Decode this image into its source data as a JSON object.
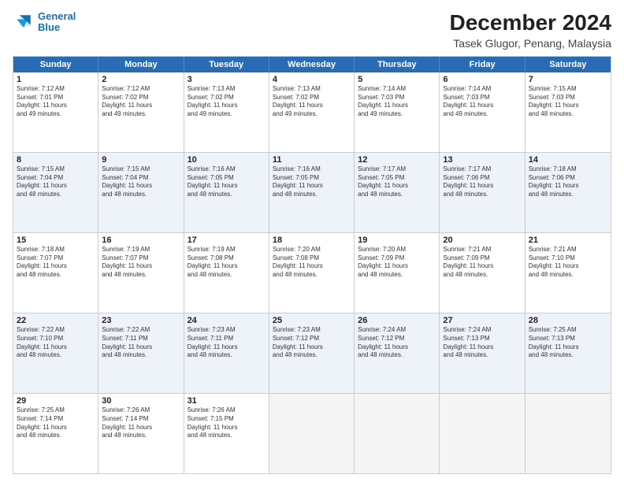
{
  "logo": {
    "line1": "General",
    "line2": "Blue"
  },
  "title": "December 2024",
  "subtitle": "Tasek Glugor, Penang, Malaysia",
  "days_of_week": [
    "Sunday",
    "Monday",
    "Tuesday",
    "Wednesday",
    "Thursday",
    "Friday",
    "Saturday"
  ],
  "weeks": [
    [
      {
        "day": "1",
        "sunrise": "7:12 AM",
        "sunset": "7:01 PM",
        "daylight": "11 hours and 49 minutes."
      },
      {
        "day": "2",
        "sunrise": "7:12 AM",
        "sunset": "7:02 PM",
        "daylight": "11 hours and 49 minutes."
      },
      {
        "day": "3",
        "sunrise": "7:13 AM",
        "sunset": "7:02 PM",
        "daylight": "11 hours and 49 minutes."
      },
      {
        "day": "4",
        "sunrise": "7:13 AM",
        "sunset": "7:02 PM",
        "daylight": "11 hours and 49 minutes."
      },
      {
        "day": "5",
        "sunrise": "7:14 AM",
        "sunset": "7:03 PM",
        "daylight": "11 hours and 49 minutes."
      },
      {
        "day": "6",
        "sunrise": "7:14 AM",
        "sunset": "7:03 PM",
        "daylight": "11 hours and 49 minutes."
      },
      {
        "day": "7",
        "sunrise": "7:15 AM",
        "sunset": "7:03 PM",
        "daylight": "11 hours and 48 minutes."
      }
    ],
    [
      {
        "day": "8",
        "sunrise": "7:15 AM",
        "sunset": "7:04 PM",
        "daylight": "11 hours and 48 minutes."
      },
      {
        "day": "9",
        "sunrise": "7:15 AM",
        "sunset": "7:04 PM",
        "daylight": "11 hours and 48 minutes."
      },
      {
        "day": "10",
        "sunrise": "7:16 AM",
        "sunset": "7:05 PM",
        "daylight": "11 hours and 48 minutes."
      },
      {
        "day": "11",
        "sunrise": "7:16 AM",
        "sunset": "7:05 PM",
        "daylight": "11 hours and 48 minutes."
      },
      {
        "day": "12",
        "sunrise": "7:17 AM",
        "sunset": "7:05 PM",
        "daylight": "11 hours and 48 minutes."
      },
      {
        "day": "13",
        "sunrise": "7:17 AM",
        "sunset": "7:06 PM",
        "daylight": "11 hours and 48 minutes."
      },
      {
        "day": "14",
        "sunrise": "7:18 AM",
        "sunset": "7:06 PM",
        "daylight": "11 hours and 48 minutes."
      }
    ],
    [
      {
        "day": "15",
        "sunrise": "7:18 AM",
        "sunset": "7:07 PM",
        "daylight": "11 hours and 48 minutes."
      },
      {
        "day": "16",
        "sunrise": "7:19 AM",
        "sunset": "7:07 PM",
        "daylight": "11 hours and 48 minutes."
      },
      {
        "day": "17",
        "sunrise": "7:19 AM",
        "sunset": "7:08 PM",
        "daylight": "11 hours and 48 minutes."
      },
      {
        "day": "18",
        "sunrise": "7:20 AM",
        "sunset": "7:08 PM",
        "daylight": "11 hours and 48 minutes."
      },
      {
        "day": "19",
        "sunrise": "7:20 AM",
        "sunset": "7:09 PM",
        "daylight": "11 hours and 48 minutes."
      },
      {
        "day": "20",
        "sunrise": "7:21 AM",
        "sunset": "7:09 PM",
        "daylight": "11 hours and 48 minutes."
      },
      {
        "day": "21",
        "sunrise": "7:21 AM",
        "sunset": "7:10 PM",
        "daylight": "11 hours and 48 minutes."
      }
    ],
    [
      {
        "day": "22",
        "sunrise": "7:22 AM",
        "sunset": "7:10 PM",
        "daylight": "11 hours and 48 minutes."
      },
      {
        "day": "23",
        "sunrise": "7:22 AM",
        "sunset": "7:11 PM",
        "daylight": "11 hours and 48 minutes."
      },
      {
        "day": "24",
        "sunrise": "7:23 AM",
        "sunset": "7:11 PM",
        "daylight": "11 hours and 48 minutes."
      },
      {
        "day": "25",
        "sunrise": "7:23 AM",
        "sunset": "7:12 PM",
        "daylight": "11 hours and 48 minutes."
      },
      {
        "day": "26",
        "sunrise": "7:24 AM",
        "sunset": "7:12 PM",
        "daylight": "11 hours and 48 minutes."
      },
      {
        "day": "27",
        "sunrise": "7:24 AM",
        "sunset": "7:13 PM",
        "daylight": "11 hours and 48 minutes."
      },
      {
        "day": "28",
        "sunrise": "7:25 AM",
        "sunset": "7:13 PM",
        "daylight": "11 hours and 48 minutes."
      }
    ],
    [
      {
        "day": "29",
        "sunrise": "7:25 AM",
        "sunset": "7:14 PM",
        "daylight": "11 hours and 48 minutes."
      },
      {
        "day": "30",
        "sunrise": "7:26 AM",
        "sunset": "7:14 PM",
        "daylight": "11 hours and 48 minutes."
      },
      {
        "day": "31",
        "sunrise": "7:26 AM",
        "sunset": "7:15 PM",
        "daylight": "11 hours and 48 minutes."
      },
      null,
      null,
      null,
      null
    ]
  ],
  "labels": {
    "sunrise": "Sunrise:",
    "sunset": "Sunset:",
    "daylight": "Daylight:"
  }
}
